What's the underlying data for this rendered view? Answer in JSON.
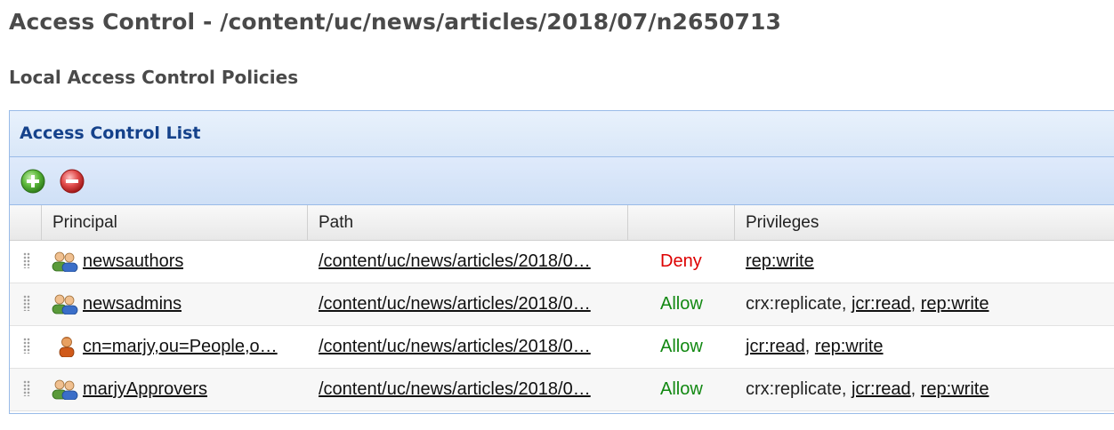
{
  "page": {
    "title": "Access Control - /content/uc/news/articles/2018/07/n2650713",
    "section_title": "Local Access Control Policies"
  },
  "panel": {
    "title": "Access Control List",
    "toolbar": {
      "add_icon": "plus-circle-green",
      "remove_icon": "minus-circle-red"
    }
  },
  "grid": {
    "columns": {
      "principal": "Principal",
      "path": "Path",
      "effect": "",
      "privileges": "Privileges"
    },
    "rows": [
      {
        "principal_icon": "group-icon",
        "principal": "newsauthors",
        "path": "/content/uc/news/articles/2018/0…",
        "effect": "Deny",
        "privileges": [
          {
            "text": "rep:write",
            "link": true
          }
        ]
      },
      {
        "principal_icon": "group-icon",
        "principal": "newsadmins",
        "path": "/content/uc/news/articles/2018/0…",
        "effect": "Allow",
        "privileges": [
          {
            "text": "crx:replicate",
            "link": false
          },
          {
            "text": "jcr:read",
            "link": true
          },
          {
            "text": "rep:write",
            "link": true
          }
        ]
      },
      {
        "principal_icon": "user-icon",
        "principal": "cn=marjy,ou=People,o…",
        "path": "/content/uc/news/articles/2018/0…",
        "effect": "Allow",
        "privileges": [
          {
            "text": "jcr:read",
            "link": true
          },
          {
            "text": "rep:write",
            "link": true
          }
        ]
      },
      {
        "principal_icon": "group-icon",
        "principal": "marjyApprovers",
        "path": "/content/uc/news/articles/2018/0…",
        "effect": "Allow",
        "privileges": [
          {
            "text": "crx:replicate",
            "link": false
          },
          {
            "text": "jcr:read",
            "link": true
          },
          {
            "text": "rep:write",
            "link": true
          }
        ]
      }
    ]
  },
  "colors": {
    "deny": "#dd0000",
    "allow": "#118811",
    "panel_title": "#15428b"
  }
}
